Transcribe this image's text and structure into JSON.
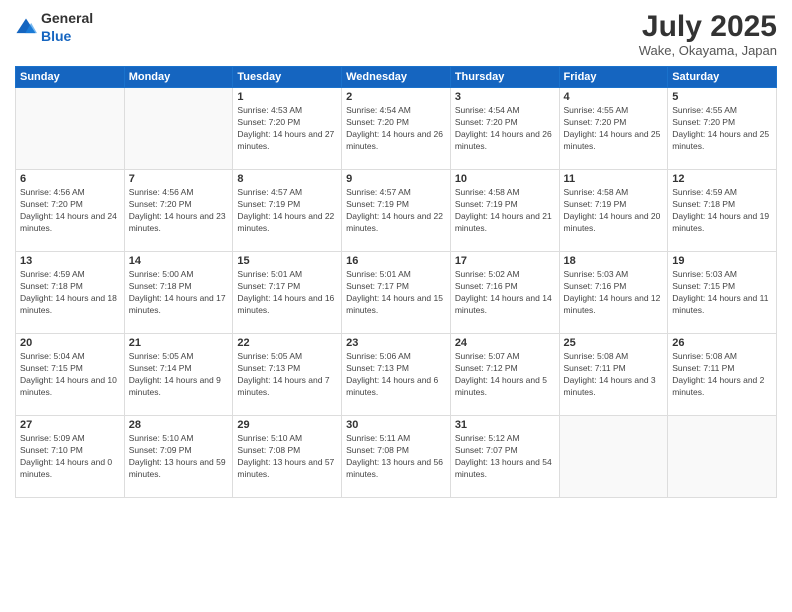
{
  "header": {
    "logo_general": "General",
    "logo_blue": "Blue",
    "month_year": "July 2025",
    "location": "Wake, Okayama, Japan"
  },
  "days_of_week": [
    "Sunday",
    "Monday",
    "Tuesday",
    "Wednesday",
    "Thursday",
    "Friday",
    "Saturday"
  ],
  "weeks": [
    [
      {
        "day": "",
        "info": ""
      },
      {
        "day": "",
        "info": ""
      },
      {
        "day": "1",
        "info": "Sunrise: 4:53 AM\nSunset: 7:20 PM\nDaylight: 14 hours and 27 minutes."
      },
      {
        "day": "2",
        "info": "Sunrise: 4:54 AM\nSunset: 7:20 PM\nDaylight: 14 hours and 26 minutes."
      },
      {
        "day": "3",
        "info": "Sunrise: 4:54 AM\nSunset: 7:20 PM\nDaylight: 14 hours and 26 minutes."
      },
      {
        "day": "4",
        "info": "Sunrise: 4:55 AM\nSunset: 7:20 PM\nDaylight: 14 hours and 25 minutes."
      },
      {
        "day": "5",
        "info": "Sunrise: 4:55 AM\nSunset: 7:20 PM\nDaylight: 14 hours and 25 minutes."
      }
    ],
    [
      {
        "day": "6",
        "info": "Sunrise: 4:56 AM\nSunset: 7:20 PM\nDaylight: 14 hours and 24 minutes."
      },
      {
        "day": "7",
        "info": "Sunrise: 4:56 AM\nSunset: 7:20 PM\nDaylight: 14 hours and 23 minutes."
      },
      {
        "day": "8",
        "info": "Sunrise: 4:57 AM\nSunset: 7:19 PM\nDaylight: 14 hours and 22 minutes."
      },
      {
        "day": "9",
        "info": "Sunrise: 4:57 AM\nSunset: 7:19 PM\nDaylight: 14 hours and 22 minutes."
      },
      {
        "day": "10",
        "info": "Sunrise: 4:58 AM\nSunset: 7:19 PM\nDaylight: 14 hours and 21 minutes."
      },
      {
        "day": "11",
        "info": "Sunrise: 4:58 AM\nSunset: 7:19 PM\nDaylight: 14 hours and 20 minutes."
      },
      {
        "day": "12",
        "info": "Sunrise: 4:59 AM\nSunset: 7:18 PM\nDaylight: 14 hours and 19 minutes."
      }
    ],
    [
      {
        "day": "13",
        "info": "Sunrise: 4:59 AM\nSunset: 7:18 PM\nDaylight: 14 hours and 18 minutes."
      },
      {
        "day": "14",
        "info": "Sunrise: 5:00 AM\nSunset: 7:18 PM\nDaylight: 14 hours and 17 minutes."
      },
      {
        "day": "15",
        "info": "Sunrise: 5:01 AM\nSunset: 7:17 PM\nDaylight: 14 hours and 16 minutes."
      },
      {
        "day": "16",
        "info": "Sunrise: 5:01 AM\nSunset: 7:17 PM\nDaylight: 14 hours and 15 minutes."
      },
      {
        "day": "17",
        "info": "Sunrise: 5:02 AM\nSunset: 7:16 PM\nDaylight: 14 hours and 14 minutes."
      },
      {
        "day": "18",
        "info": "Sunrise: 5:03 AM\nSunset: 7:16 PM\nDaylight: 14 hours and 12 minutes."
      },
      {
        "day": "19",
        "info": "Sunrise: 5:03 AM\nSunset: 7:15 PM\nDaylight: 14 hours and 11 minutes."
      }
    ],
    [
      {
        "day": "20",
        "info": "Sunrise: 5:04 AM\nSunset: 7:15 PM\nDaylight: 14 hours and 10 minutes."
      },
      {
        "day": "21",
        "info": "Sunrise: 5:05 AM\nSunset: 7:14 PM\nDaylight: 14 hours and 9 minutes."
      },
      {
        "day": "22",
        "info": "Sunrise: 5:05 AM\nSunset: 7:13 PM\nDaylight: 14 hours and 7 minutes."
      },
      {
        "day": "23",
        "info": "Sunrise: 5:06 AM\nSunset: 7:13 PM\nDaylight: 14 hours and 6 minutes."
      },
      {
        "day": "24",
        "info": "Sunrise: 5:07 AM\nSunset: 7:12 PM\nDaylight: 14 hours and 5 minutes."
      },
      {
        "day": "25",
        "info": "Sunrise: 5:08 AM\nSunset: 7:11 PM\nDaylight: 14 hours and 3 minutes."
      },
      {
        "day": "26",
        "info": "Sunrise: 5:08 AM\nSunset: 7:11 PM\nDaylight: 14 hours and 2 minutes."
      }
    ],
    [
      {
        "day": "27",
        "info": "Sunrise: 5:09 AM\nSunset: 7:10 PM\nDaylight: 14 hours and 0 minutes."
      },
      {
        "day": "28",
        "info": "Sunrise: 5:10 AM\nSunset: 7:09 PM\nDaylight: 13 hours and 59 minutes."
      },
      {
        "day": "29",
        "info": "Sunrise: 5:10 AM\nSunset: 7:08 PM\nDaylight: 13 hours and 57 minutes."
      },
      {
        "day": "30",
        "info": "Sunrise: 5:11 AM\nSunset: 7:08 PM\nDaylight: 13 hours and 56 minutes."
      },
      {
        "day": "31",
        "info": "Sunrise: 5:12 AM\nSunset: 7:07 PM\nDaylight: 13 hours and 54 minutes."
      },
      {
        "day": "",
        "info": ""
      },
      {
        "day": "",
        "info": ""
      }
    ]
  ]
}
